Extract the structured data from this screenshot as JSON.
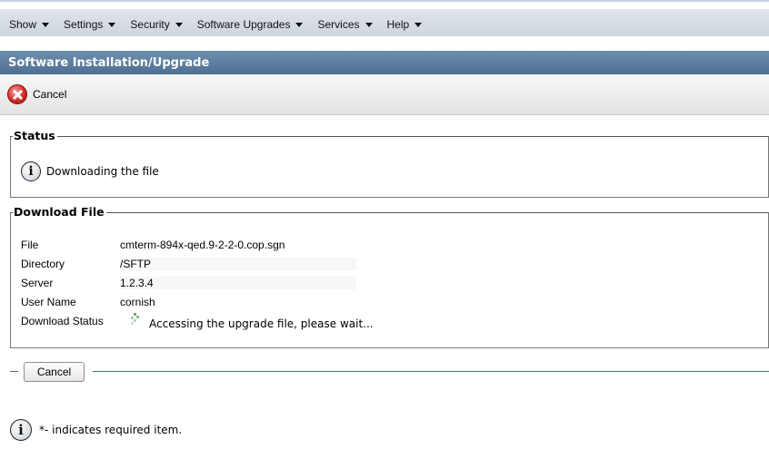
{
  "menu": {
    "items": [
      {
        "label": "Show"
      },
      {
        "label": "Settings"
      },
      {
        "label": "Security"
      },
      {
        "label": "Software Upgrades"
      },
      {
        "label": "Services"
      },
      {
        "label": "Help"
      }
    ]
  },
  "page_title": "Software Installation/Upgrade",
  "toolbar": {
    "cancel_label": "Cancel",
    "cancel_icon": "cancel-x-icon"
  },
  "status": {
    "legend": "Status",
    "icon": "info-icon",
    "message": "Downloading the file"
  },
  "download": {
    "legend": "Download File",
    "fields": [
      {
        "label": "File",
        "value": "cmterm-894x-qed.9-2-2-0.cop.sgn"
      },
      {
        "label": "Directory",
        "value": "/SFTP"
      },
      {
        "label": "Server",
        "value": "1.2.3.4"
      },
      {
        "label": "User Name",
        "value": "cornish"
      }
    ],
    "status_label": "Download Status",
    "status_message": "Accessing the upgrade file, please wait..."
  },
  "bottom": {
    "cancel_label": "Cancel"
  },
  "footer": {
    "note": "*- indicates required item.",
    "icon": "info-icon"
  },
  "colors": {
    "title_bar": "#5a7b9c",
    "accent_line": "#3b7a63",
    "spinner": "#4e9a5f"
  }
}
